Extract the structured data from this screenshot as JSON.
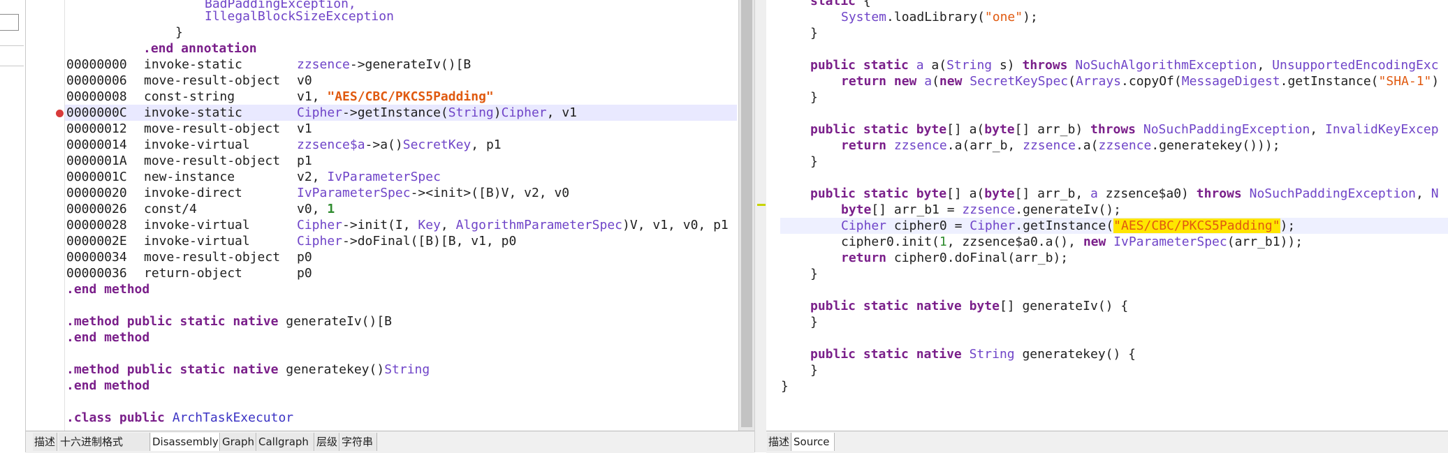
{
  "disassembly": {
    "partial_top_lines": [
      {
        "text": "BadPaddingException,"
      },
      {
        "text": "IllegalBlockSizeException"
      },
      {
        "text": "}"
      },
      {
        "text": ".end annotation"
      }
    ],
    "instructions": [
      {
        "addr": "00000000",
        "op": "invoke-static",
        "a1": "zzsence",
        "a2": "->generateIv()[B"
      },
      {
        "addr": "00000006",
        "op": "move-result-object",
        "a1": "v0"
      },
      {
        "addr": "00000008",
        "op": "const-string",
        "a1": "v1, ",
        "str": "\"AES/CBC/PKCS5Padding\""
      },
      {
        "addr": "0000000C",
        "op": "invoke-static",
        "a1": "Cipher",
        "a2": "->getInstance(",
        "a3": "String",
        "a4": ")",
        "a5": "Cipher",
        "a6": ", v1"
      },
      {
        "addr": "00000012",
        "op": "move-result-object",
        "a1": "v1"
      },
      {
        "addr": "00000014",
        "op": "invoke-virtual",
        "a1": "zzsence$a",
        "a2": "->a()",
        "a3": "SecretKey",
        "a4": ", p1"
      },
      {
        "addr": "0000001A",
        "op": "move-result-object",
        "a1": "p1"
      },
      {
        "addr": "0000001C",
        "op": "new-instance",
        "a1": "v2, ",
        "a2": "IvParameterSpec"
      },
      {
        "addr": "00000020",
        "op": "invoke-direct",
        "a1": "IvParameterSpec",
        "a2": "-><init>([B)V, v2, v0"
      },
      {
        "addr": "00000026",
        "op": "const/4",
        "a1": "v0, ",
        "num": "1"
      },
      {
        "addr": "00000028",
        "op": "invoke-virtual",
        "a1": "Cipher",
        "a2": "->init(I, ",
        "a3": "Key",
        "a4": ", ",
        "a5": "AlgorithmParameterSpec",
        "a6": ")V, v1, v0, p1"
      },
      {
        "addr": "0000002E",
        "op": "invoke-virtual",
        "a1": "Cipher",
        "a2": "->doFinal([B)[B, v1, p0"
      },
      {
        "addr": "00000034",
        "op": "move-result-object",
        "a1": "p0"
      },
      {
        "addr": "00000036",
        "op": "return-object",
        "a1": "p0"
      }
    ],
    "end_method": ".end method",
    "method1": {
      "directive": ".method",
      "mods": "public static native",
      "name": "generateIv()[B"
    },
    "method2": {
      "directive": ".method",
      "mods": "public static native",
      "name": "generatekey()",
      "ret": "String"
    },
    "class_line": {
      "directive": ".class",
      "mods": "public",
      "name": "ArchTaskExecutor"
    },
    "tabs": [
      "描述",
      "十六进制格式",
      "Disassembly",
      "Graph",
      "Callgraph",
      "层级",
      "字符串"
    ],
    "active_tab": "Disassembly"
  },
  "source": {
    "l0_kw": "static",
    "l0_rest": " {",
    "l1_a": "System",
    "l1_b": ".loadLibrary(",
    "l1_str": "\"one\"",
    "l1_c": ");",
    "close": "}",
    "m1": {
      "kw": "public static",
      "ty": "a",
      "name": " a(",
      "ty2": "String",
      "mid": " s) ",
      "kw2": "throws",
      "ex1": "NoSuchAlgorithmException",
      "sep": ", ",
      "ex2": "UnsupportedEncodingExc"
    },
    "m1_body": {
      "kw": "return new",
      "a": " ",
      "ty": "a",
      "b": "(",
      "kw2": "new",
      "c": " ",
      "ty2": "SecretKeySpec",
      "d": "(",
      "ty3": "Arrays",
      "e": ".copyOf(",
      "ty4": "MessageDigest",
      "f": ".getInstance(",
      "str": "\"SHA-1\"",
      "g": ")"
    },
    "m2": {
      "kw": "public static byte",
      "a": "[] a(",
      "kw2": "byte",
      "b": "[] arr_b) ",
      "kw3": "throws",
      "ex1": "NoSuchPaddingException",
      "sep": ", ",
      "ex2": "InvalidKeyExcep"
    },
    "m2_body": {
      "kw": "return",
      "a": " ",
      "ty": "zzsence",
      "b": ".a(arr_b, ",
      "ty2": "zzsence",
      "c": ".a(",
      "ty3": "zzsence",
      "d": ".generatekey()));"
    },
    "m3": {
      "kw": "public static byte",
      "a": "[] a(",
      "kw2": "byte",
      "b": "[] arr_b, ",
      "ty": "a",
      "c": " zzsence$a0) ",
      "kw3": "throws",
      "ex1": "NoSuchPaddingException",
      "sep": ", ",
      "ex2": "N"
    },
    "m3_l1": {
      "kw": "byte",
      "a": "[] arr_b1 = ",
      "ty": "zzsence",
      "b": ".generateIv();"
    },
    "m3_l2": {
      "ty": "Cipher",
      "a": " cipher0 = ",
      "ty2": "Cipher",
      "b": ".getInstance(",
      "str": "\"AES/CBC/PKCS5Padding\"",
      "c": ");"
    },
    "m3_l3": {
      "a": "cipher0.init(",
      "num": "1",
      "b": ", zzsence$a0.a(), ",
      "kw": "new",
      "c": " ",
      "ty": "IvParameterSpec",
      "d": "(arr_b1));"
    },
    "m3_l4": {
      "kw": "return",
      "a": " cipher0.doFinal(arr_b);"
    },
    "m4": {
      "kw": "public static native byte",
      "a": "[] generateIv() {"
    },
    "m5": {
      "kw": "public static native",
      "a": " ",
      "ty": "String",
      "b": " generatekey() {"
    },
    "tabs": [
      "描述",
      "Source"
    ],
    "active_tab": "Source"
  },
  "colors": {
    "keyword": "#7a1f8a",
    "type": "#6f44c8",
    "string": "#e05a10",
    "number": "#2e8b2e",
    "highlight": "#ffe600",
    "breakpoint": "#d83a3a"
  }
}
